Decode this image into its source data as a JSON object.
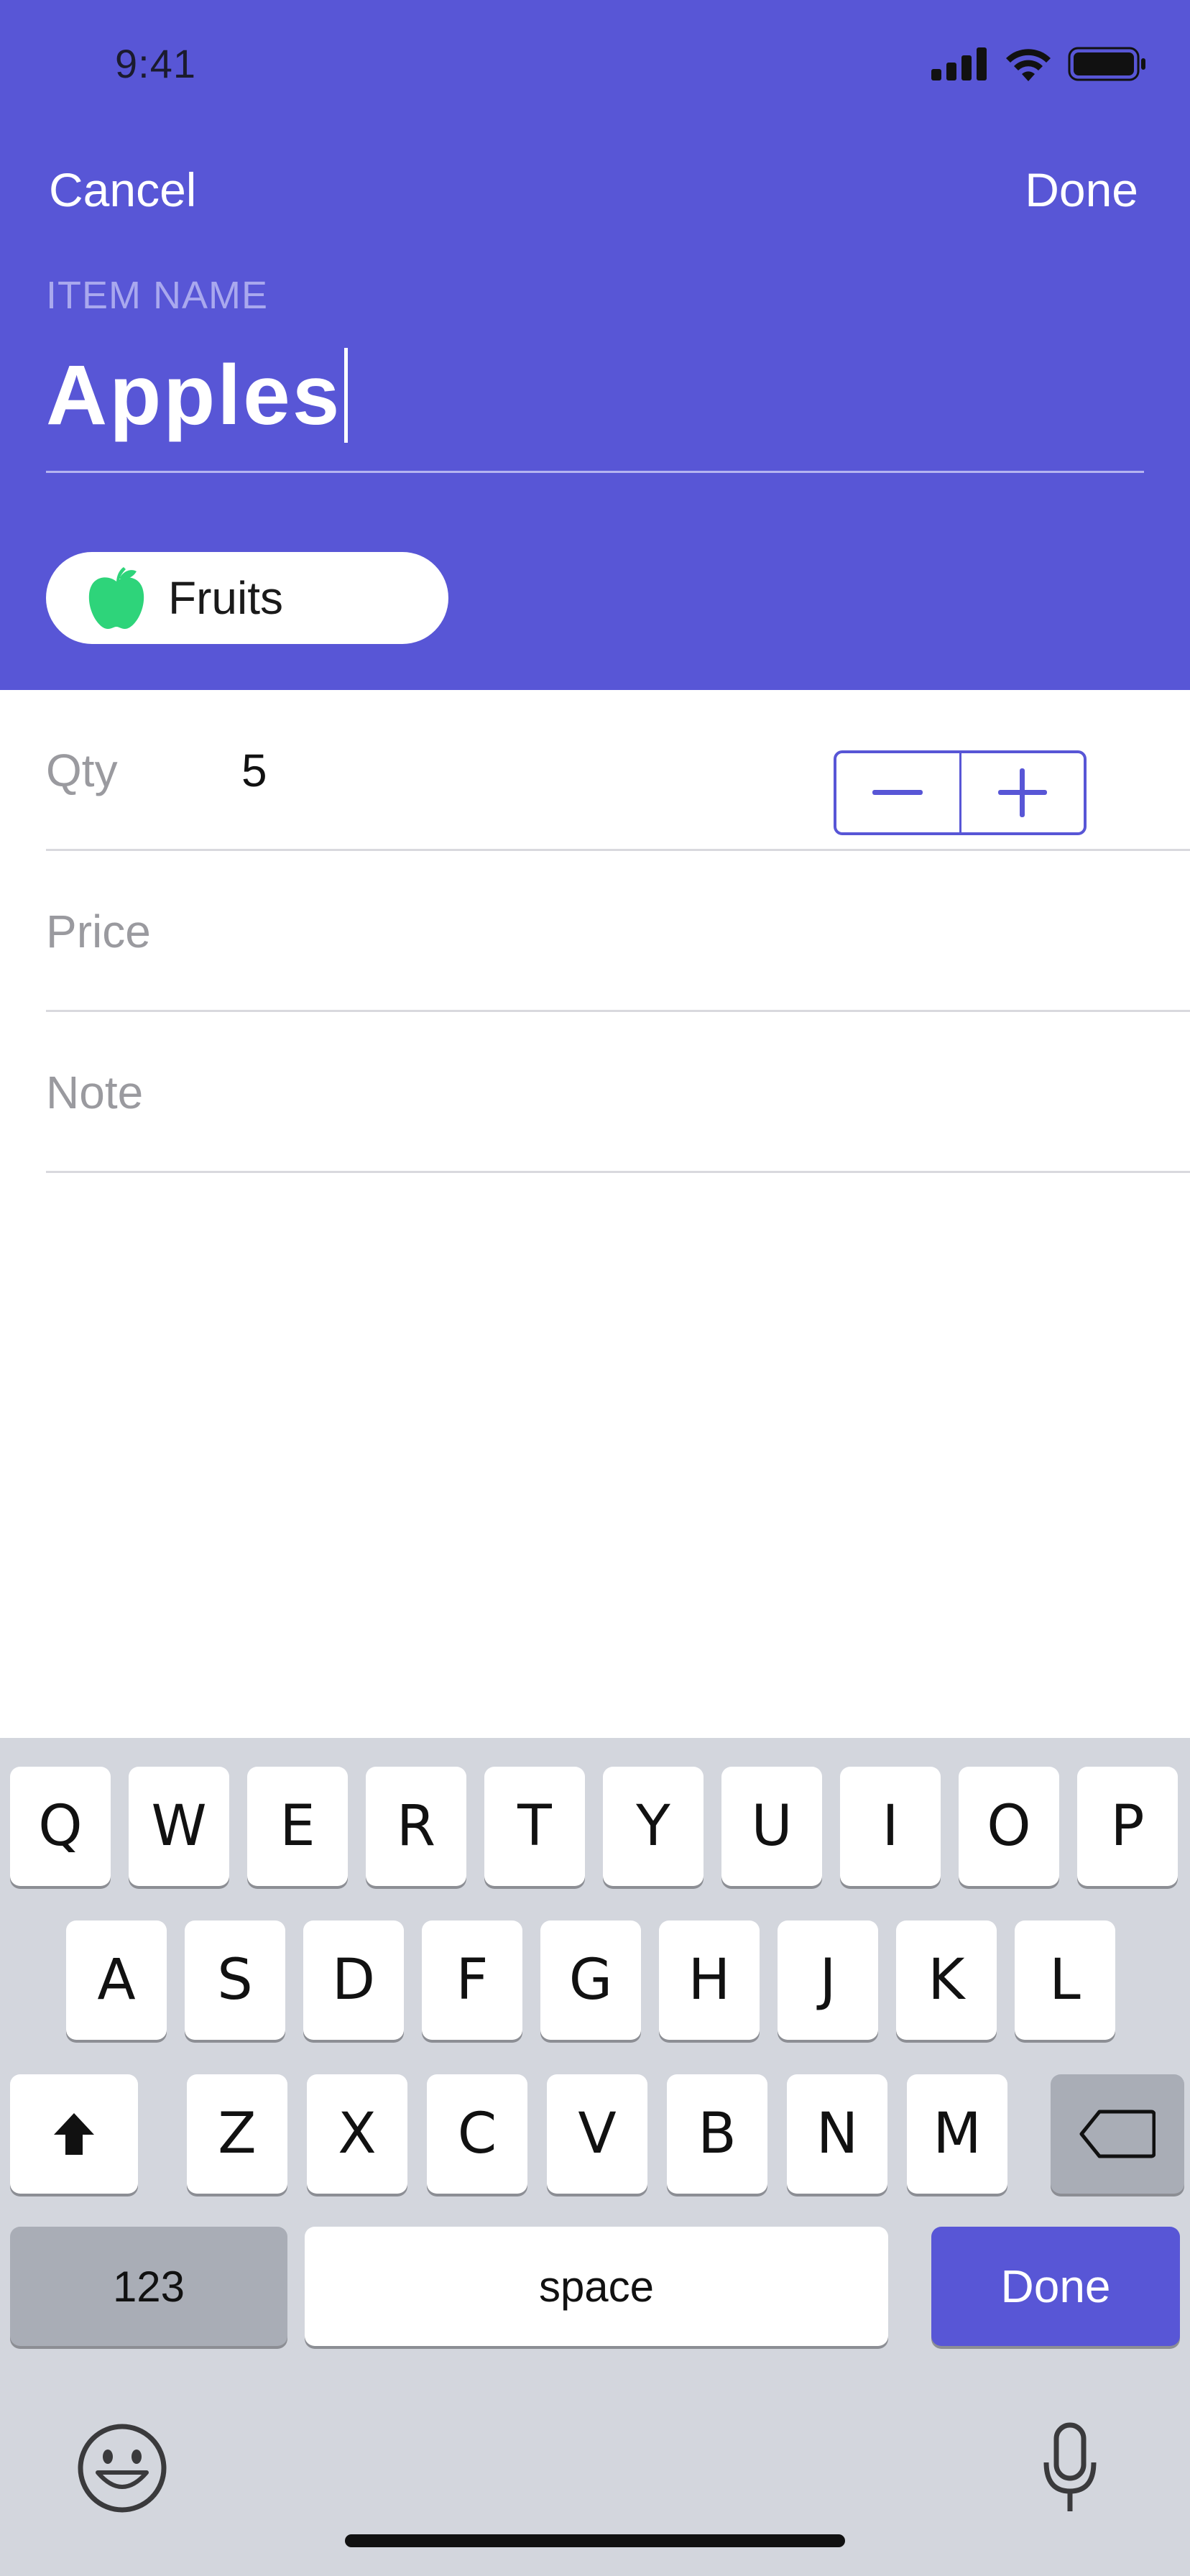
{
  "status_bar": {
    "time": "9:41"
  },
  "nav": {
    "cancel_label": "Cancel",
    "done_label": "Done"
  },
  "item": {
    "label": "ITEM NAME",
    "name": "Apples"
  },
  "category": {
    "icon": "apple-icon",
    "label": "Fruits"
  },
  "form": {
    "qty": {
      "label": "Qty",
      "value": "5"
    },
    "price": {
      "label": "Price",
      "value": ""
    },
    "note": {
      "label": "Note",
      "value": ""
    }
  },
  "keyboard": {
    "row1": [
      "Q",
      "W",
      "E",
      "R",
      "T",
      "Y",
      "U",
      "I",
      "O",
      "P"
    ],
    "row2": [
      "A",
      "S",
      "D",
      "F",
      "G",
      "H",
      "J",
      "K",
      "L"
    ],
    "row3": [
      "Z",
      "X",
      "C",
      "V",
      "B",
      "N",
      "M"
    ],
    "numbers_label": "123",
    "space_label": "space",
    "done_label": "Done"
  },
  "colors": {
    "accent": "#5856D6",
    "category_icon": "#2ED47A",
    "keyboard_bg": "#D3D6DD"
  }
}
